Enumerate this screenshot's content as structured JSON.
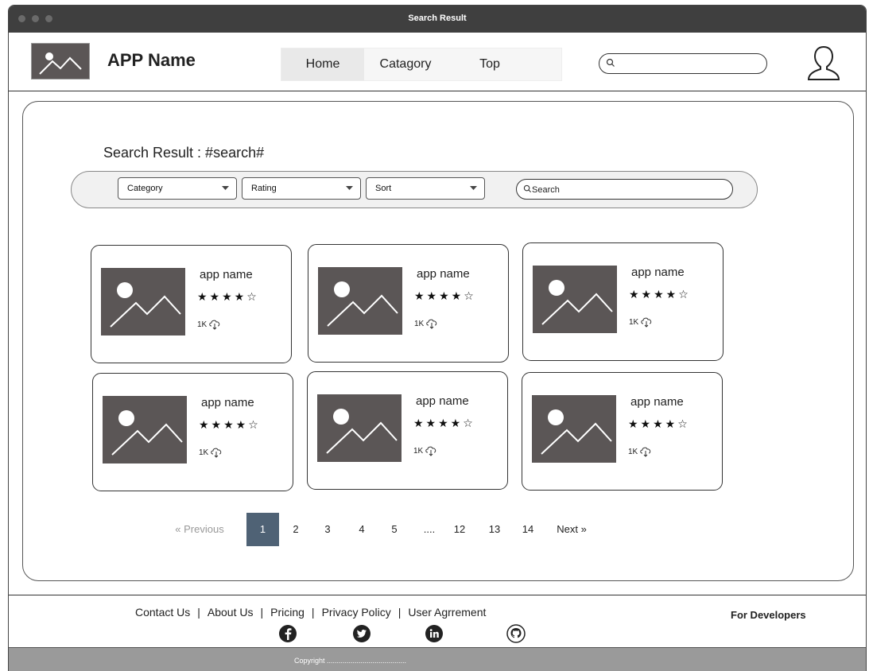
{
  "window": {
    "title": "Search Result"
  },
  "header": {
    "app_name": "APP Name",
    "nav": [
      {
        "label": "Home",
        "active": true
      },
      {
        "label": "Catagory",
        "active": false
      },
      {
        "label": "Top",
        "active": false
      }
    ],
    "search": {
      "value": "",
      "placeholder": ""
    }
  },
  "main": {
    "result_title": "Search Result : #search#",
    "filters": {
      "category": "Category",
      "rating": "Rating",
      "sort": "Sort",
      "search_placeholder": "Search"
    },
    "cards": [
      {
        "name": "app name",
        "stars": "★★★★☆",
        "rating": 4,
        "downloads": "1K"
      },
      {
        "name": "app name",
        "stars": "★★★★☆",
        "rating": 4,
        "downloads": "1K"
      },
      {
        "name": "app name",
        "stars": "★★★★☆",
        "rating": 4,
        "downloads": "1K"
      },
      {
        "name": "app name",
        "stars": "★★★★☆",
        "rating": 4,
        "downloads": "1K"
      },
      {
        "name": "app name",
        "stars": "★★★★☆",
        "rating": 4,
        "downloads": "1K"
      },
      {
        "name": "app name",
        "stars": "★★★★☆",
        "rating": 4,
        "downloads": "1K"
      }
    ],
    "pagination": {
      "previous": "Previous",
      "next": "Next",
      "pages": [
        "1",
        "2",
        "3",
        "4",
        "5",
        "....",
        "12",
        "13",
        "14"
      ],
      "current": "1"
    }
  },
  "footer": {
    "links": [
      "Contact Us",
      "About Us",
      "Pricing",
      "Privacy Policy",
      "User Agrrement"
    ],
    "separator": "|",
    "for_developers": "For Developers",
    "social_icons": [
      "facebook-icon",
      "twitter-icon",
      "linkedin-icon",
      "github-icon"
    ],
    "copyright": "Copyright ........................................"
  },
  "colors": {
    "titlebar": "#3f3f3f",
    "image_placeholder": "#5b5656",
    "active_page": "#4f6275",
    "copyright_bar": "#9a9a9a"
  }
}
